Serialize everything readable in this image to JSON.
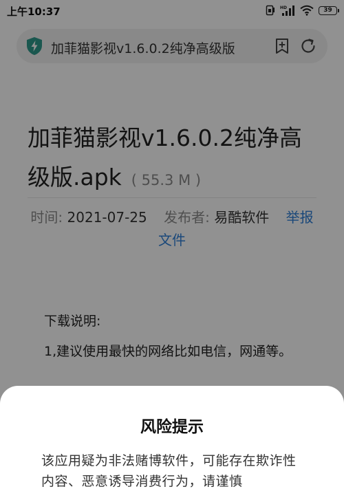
{
  "status_bar": {
    "time": "上午10:37",
    "network_type": "HD",
    "battery": "39"
  },
  "address_bar": {
    "title": "加菲猫影视v1.6.0.2纯净高级版"
  },
  "file": {
    "title": "加菲猫影视v1.6.0.2纯净高级版.apk",
    "size": "( 55.3 M )"
  },
  "meta": {
    "time_label": "时间:",
    "time_value": "2021-07-25",
    "publisher_label": "发布者:",
    "publisher_value": "易酷软件",
    "report_link": "举报文件"
  },
  "instructions": {
    "heading": "下载说明:",
    "item1": "1,建议使用最快的网络比如电信，网通等。"
  },
  "dialog": {
    "title": "风险提示",
    "message": "该应用疑为非法赌博软件，可能存在欺诈性内容、恶意诱导消费行为，请谨慎"
  },
  "colors": {
    "link": "#2f7fd6",
    "shield": "#2e9a8c",
    "overlay": "rgba(0,0,0,0.43)"
  },
  "icons": [
    "shield-icon",
    "bookmark-add-icon",
    "refresh-icon",
    "sim-icon",
    "signal-icon",
    "wifi-icon",
    "battery-icon"
  ]
}
